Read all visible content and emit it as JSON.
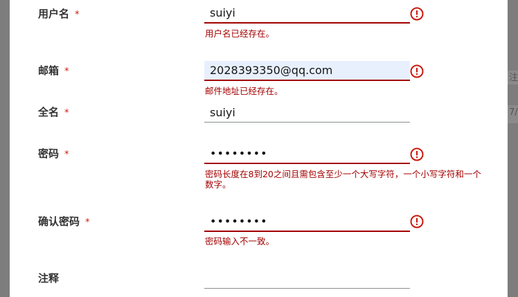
{
  "form": {
    "required_mark": "*",
    "username": {
      "label": "用户名",
      "value": "suiyi",
      "error": "用户名已经存在。"
    },
    "email": {
      "label": "邮箱",
      "value": "2028393350@qq.com",
      "error": "邮件地址已经存在。"
    },
    "fullname": {
      "label": "全名",
      "value": "suiyi"
    },
    "password": {
      "label": "密码",
      "value": "••••••••",
      "error": "密码长度在8到20之间且需包含至少一个大写字符，一个小写字符和一个数字。"
    },
    "confirm_password": {
      "label": "确认密码",
      "value": "••••••••",
      "error": "密码输入不一致。"
    },
    "notes": {
      "label": "注释",
      "value": ""
    }
  },
  "background_fragments": {
    "right_1": "注",
    "right_2": "7/"
  },
  "colors": {
    "error": "#a30000",
    "required": "#c9190b",
    "autofill": "#e8f0fe",
    "overlay": "#7d7d7d"
  },
  "icons": {
    "field_error": "exclamation-circle-icon"
  }
}
